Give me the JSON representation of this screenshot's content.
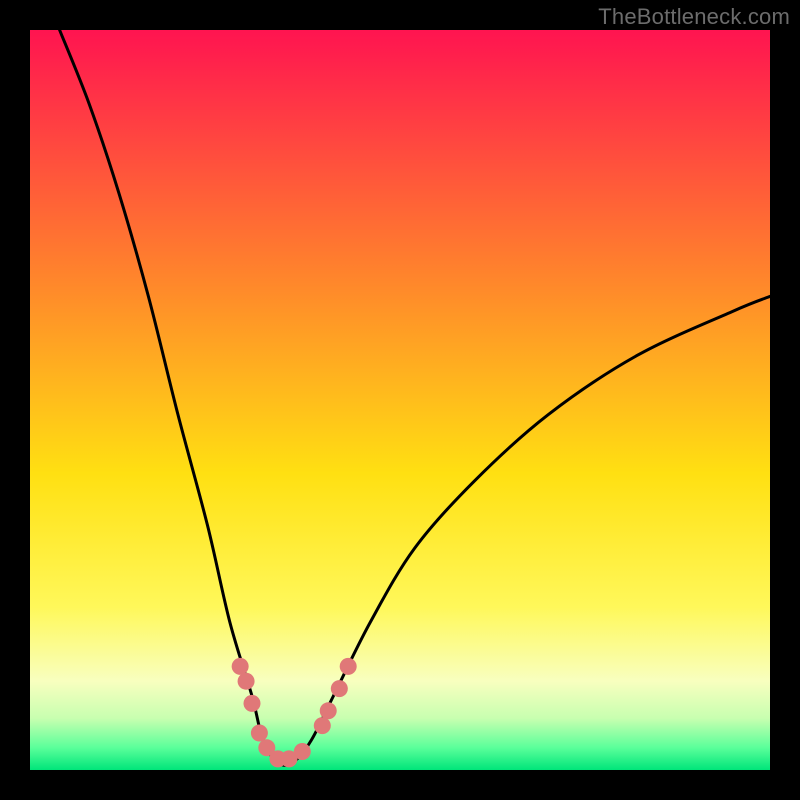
{
  "watermark": {
    "text": "TheBottleneck.com"
  },
  "chart_data": {
    "type": "line",
    "title": "",
    "xlabel": "",
    "ylabel": "",
    "xlim": [
      0,
      1
    ],
    "ylim": [
      0,
      100
    ],
    "background_gradient_stops": [
      {
        "offset": 0.0,
        "color": "#ff1450"
      },
      {
        "offset": 0.35,
        "color": "#ff8a2a"
      },
      {
        "offset": 0.6,
        "color": "#ffe012"
      },
      {
        "offset": 0.78,
        "color": "#fff85a"
      },
      {
        "offset": 0.88,
        "color": "#f8ffbf"
      },
      {
        "offset": 0.93,
        "color": "#c8ffb0"
      },
      {
        "offset": 0.97,
        "color": "#5aff9a"
      },
      {
        "offset": 1.0,
        "color": "#00e57a"
      }
    ],
    "series": [
      {
        "name": "bottleneck-curve",
        "x": [
          0.04,
          0.08,
          0.12,
          0.16,
          0.2,
          0.24,
          0.27,
          0.3,
          0.315,
          0.335,
          0.355,
          0.38,
          0.41,
          0.46,
          0.52,
          0.6,
          0.7,
          0.82,
          0.95,
          1.0
        ],
        "values": [
          100,
          90,
          78,
          64,
          48,
          33,
          20,
          10,
          4,
          1,
          1,
          4,
          10,
          20,
          30,
          39,
          48,
          56,
          62,
          64
        ]
      }
    ],
    "markers": {
      "name": "highlight-dots",
      "color": "#e07878",
      "points": [
        {
          "x": 0.284,
          "y": 14
        },
        {
          "x": 0.292,
          "y": 12
        },
        {
          "x": 0.3,
          "y": 9
        },
        {
          "x": 0.31,
          "y": 5
        },
        {
          "x": 0.32,
          "y": 3
        },
        {
          "x": 0.335,
          "y": 1.5
        },
        {
          "x": 0.35,
          "y": 1.5
        },
        {
          "x": 0.368,
          "y": 2.5
        },
        {
          "x": 0.395,
          "y": 6
        },
        {
          "x": 0.403,
          "y": 8
        },
        {
          "x": 0.418,
          "y": 11
        },
        {
          "x": 0.43,
          "y": 14
        }
      ]
    }
  }
}
